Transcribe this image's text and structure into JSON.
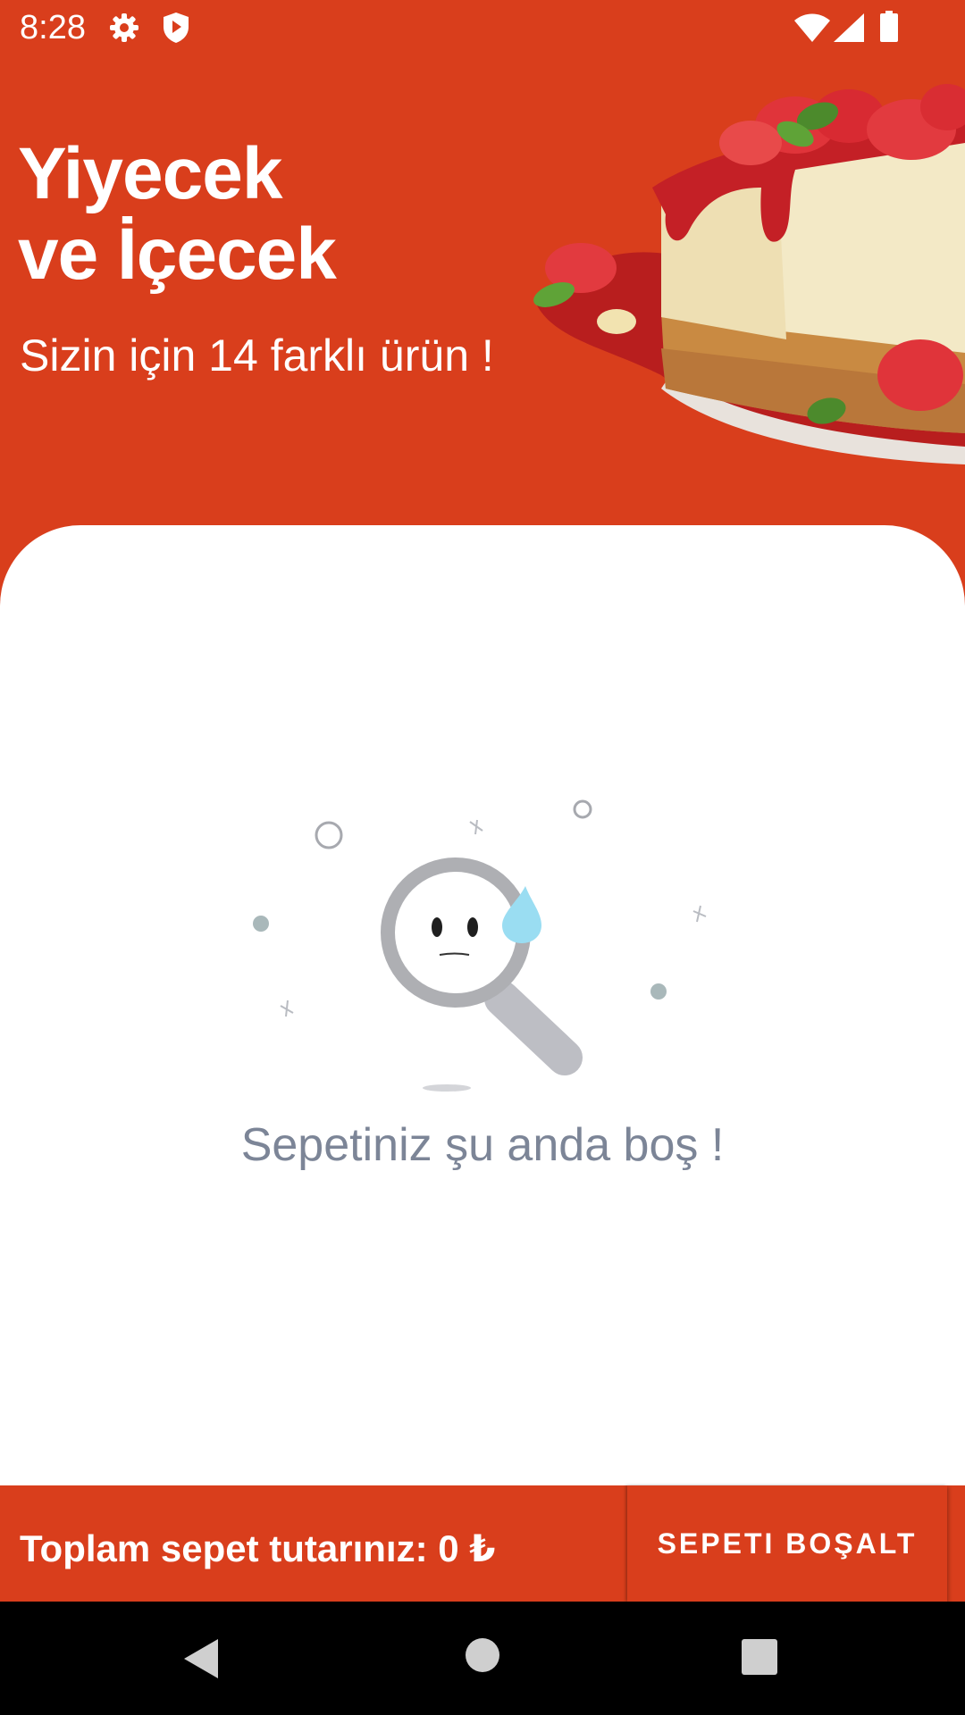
{
  "status_bar": {
    "time": "8:28",
    "icons": [
      "gear-icon",
      "shield-icon",
      "wifi-icon",
      "signal-icon",
      "battery-icon"
    ]
  },
  "header": {
    "title_line1": "Yiyecek",
    "title_line2": "ve İçecek",
    "subtitle": "Sizin için 14 farklı ürün !",
    "background_color": "#D93E1C",
    "image": "strawberry-cheesecake"
  },
  "empty_state": {
    "message": "Sepetiniz şu anda boş !",
    "icon": "sad-magnifier-icon"
  },
  "footer": {
    "total_label": "Toplam sepet tutarınız: 0 ₺",
    "clear_button_label": "SEPETI BOŞALT"
  },
  "nav_bar": {
    "icons": [
      "back-icon",
      "home-icon",
      "recents-icon"
    ]
  }
}
